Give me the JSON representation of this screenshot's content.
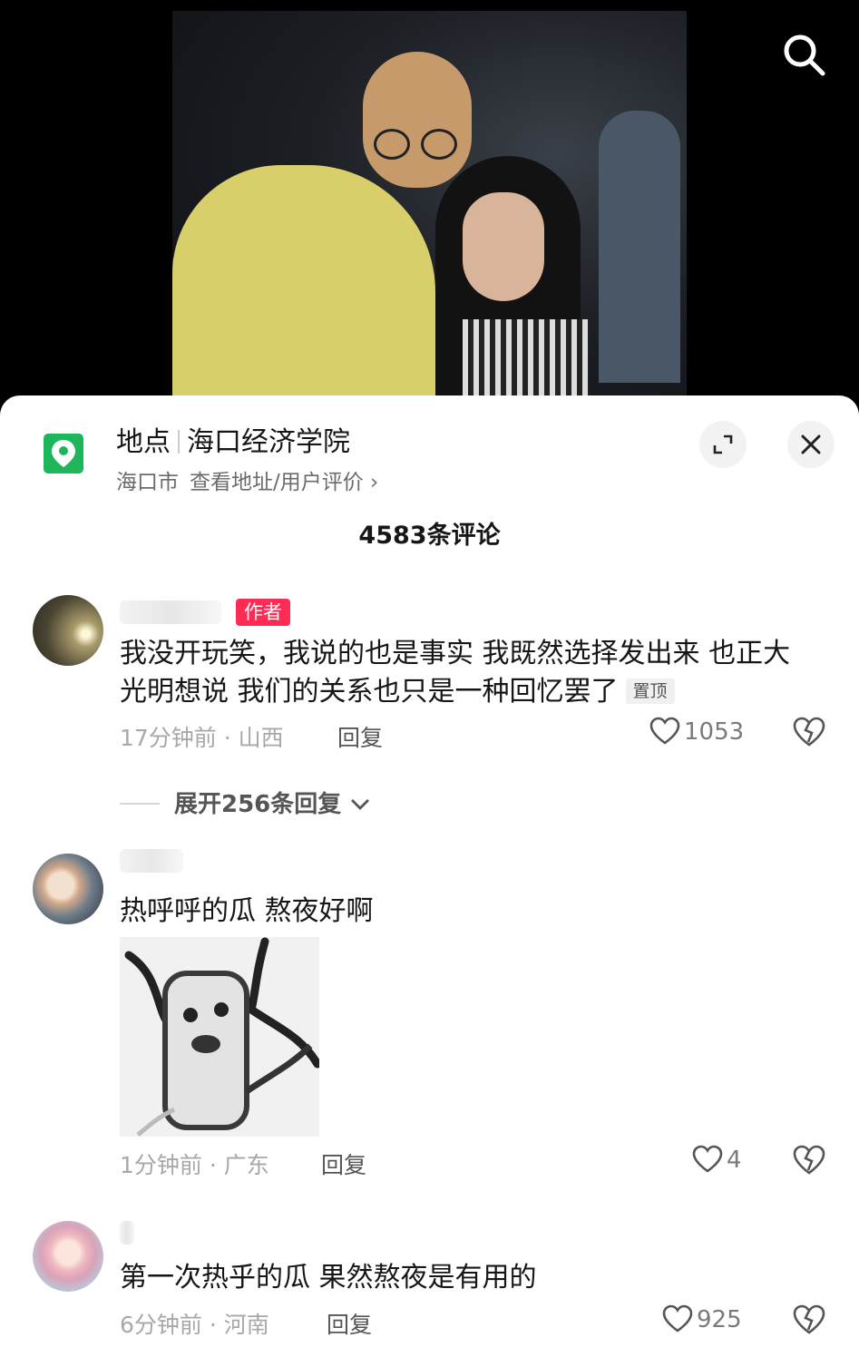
{
  "location": {
    "prefix": "地点",
    "name": "海口经济学院",
    "city": "海口市",
    "link": "查看地址/用户评价 ›"
  },
  "comment_count_label": "4583条评论",
  "comments": [
    {
      "author_tag": "作者",
      "text": "我没开玩笑，我说的也是事实 我既然选择发出来 也正大光明想说 我们的关系也只是一种回忆罢了",
      "pin_tag": "置顶",
      "meta": "17分钟前 · 山西",
      "reply_label": "回复",
      "likes": "1053",
      "expand_label": "展开256条回复"
    },
    {
      "text": "热呼呼的瓜 熬夜好啊",
      "meta": "1分钟前 · 广东",
      "reply_label": "回复",
      "likes": "4"
    },
    {
      "text": "第一次热乎的瓜 果然熬夜是有用的",
      "meta": "6分钟前 · 河南",
      "reply_label": "回复",
      "likes": "925"
    }
  ],
  "icons": {
    "search": "search-icon",
    "location": "location-pin-icon",
    "expand": "expand-icon",
    "close": "close-icon",
    "like": "heart-icon",
    "dislike": "broken-heart-icon"
  },
  "colors": {
    "accent": "#fe2c55",
    "location_green": "#1fb55a"
  }
}
